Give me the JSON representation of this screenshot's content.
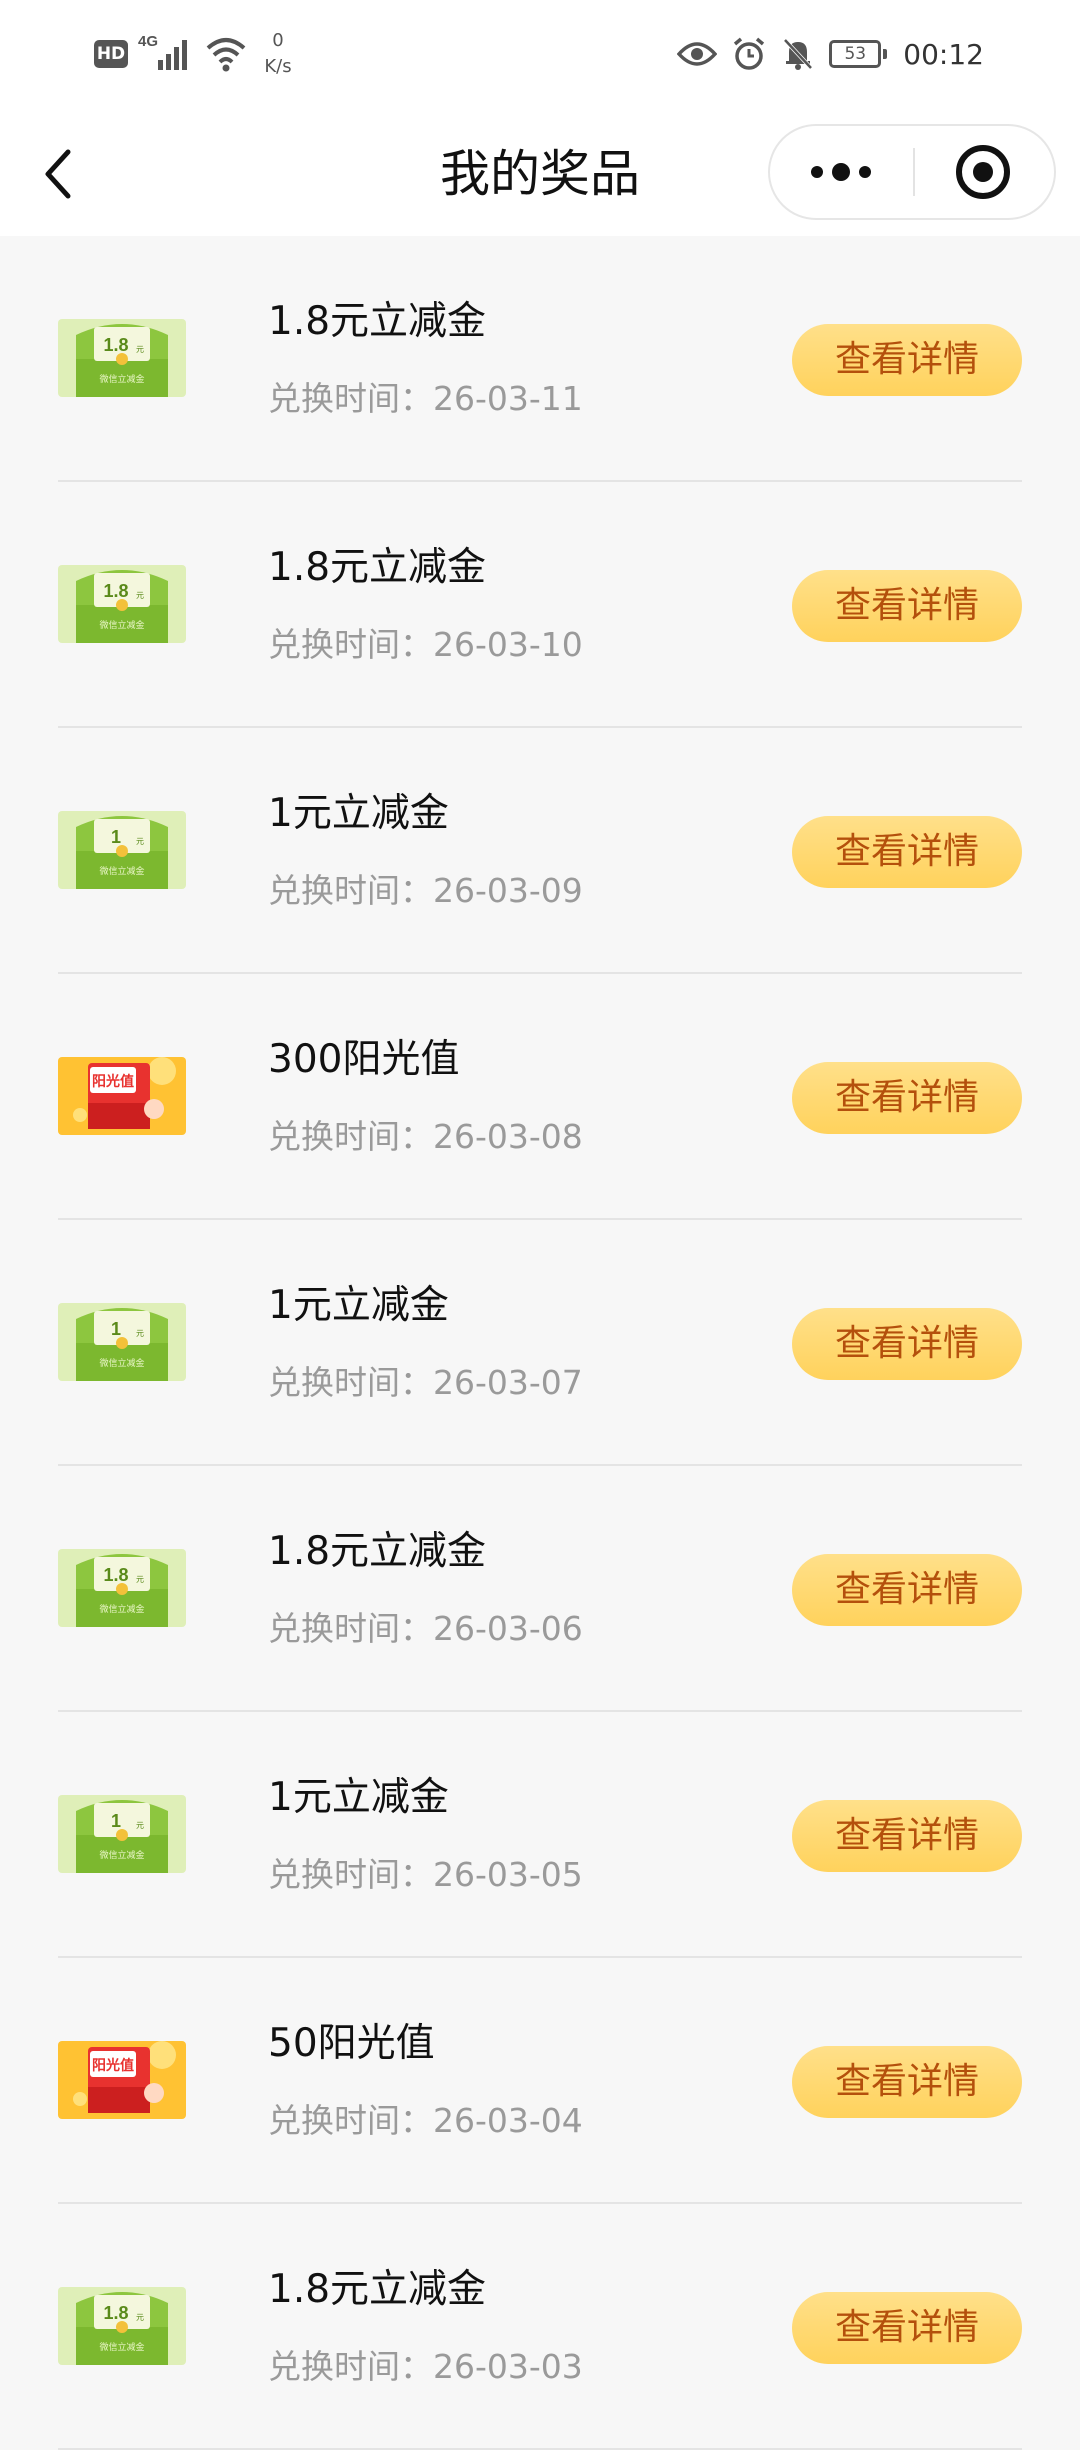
{
  "status_bar": {
    "hd": "HD",
    "network": "4G",
    "speed_value": "0",
    "speed_unit": "K/s",
    "battery": "53",
    "time": "00:12"
  },
  "nav": {
    "title": "我的奖品"
  },
  "icons": {
    "back": "chevron-left-icon",
    "more": "more-dots-icon",
    "close": "target-circle-icon"
  },
  "colors": {
    "button_bg": "#ffd25c",
    "button_text": "#b4500c",
    "coupon_green": "#8dc63f",
    "sunshine_orange": "#ffc233"
  },
  "prizes": [
    {
      "type": "coupon",
      "badge": "1.8",
      "unit": "元",
      "caption": "微信立减金",
      "name": "1.8元立减金",
      "time": "兑换时间：26-03-11",
      "button": "查看详情"
    },
    {
      "type": "coupon",
      "badge": "1.8",
      "unit": "元",
      "caption": "微信立减金",
      "name": "1.8元立减金",
      "time": "兑换时间：26-03-10",
      "button": "查看详情"
    },
    {
      "type": "coupon",
      "badge": "1",
      "unit": "元",
      "caption": "微信立减金",
      "name": "1元立减金",
      "time": "兑换时间：26-03-09",
      "button": "查看详情"
    },
    {
      "type": "sunshine",
      "badge": "阳光值",
      "name": "300阳光值",
      "time": "兑换时间：26-03-08",
      "button": "查看详情"
    },
    {
      "type": "coupon",
      "badge": "1",
      "unit": "元",
      "caption": "微信立减金",
      "name": "1元立减金",
      "time": "兑换时间：26-03-07",
      "button": "查看详情"
    },
    {
      "type": "coupon",
      "badge": "1.8",
      "unit": "元",
      "caption": "微信立减金",
      "name": "1.8元立减金",
      "time": "兑换时间：26-03-06",
      "button": "查看详情"
    },
    {
      "type": "coupon",
      "badge": "1",
      "unit": "元",
      "caption": "微信立减金",
      "name": "1元立减金",
      "time": "兑换时间：26-03-05",
      "button": "查看详情"
    },
    {
      "type": "sunshine",
      "badge": "阳光值",
      "name": "50阳光值",
      "time": "兑换时间：26-03-04",
      "button": "查看详情"
    },
    {
      "type": "coupon",
      "badge": "1.8",
      "unit": "元",
      "caption": "微信立减金",
      "name": "1.8元立减金",
      "time": "兑换时间：26-03-03",
      "button": "查看详情"
    }
  ]
}
